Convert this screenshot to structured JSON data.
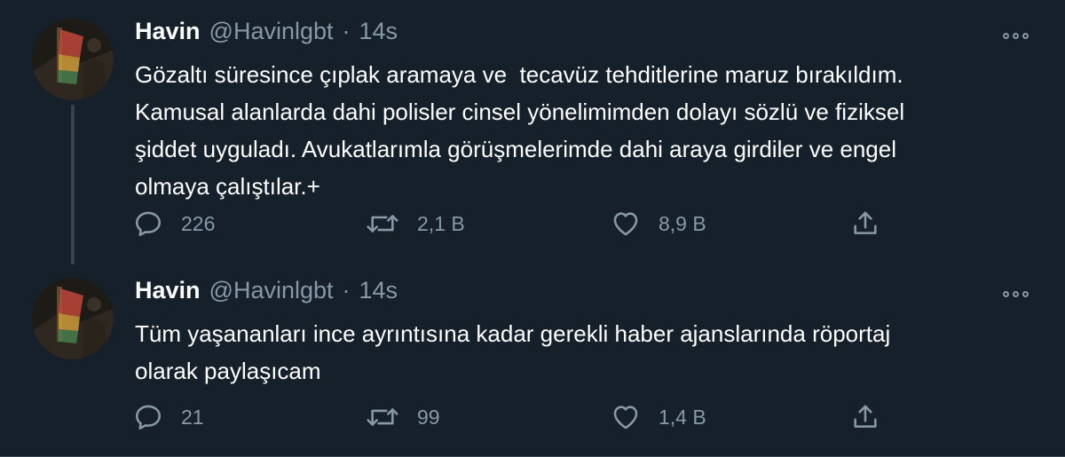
{
  "tweets": [
    {
      "author_name": "Havin",
      "handle": "@Havinlgbt",
      "separator": "·",
      "time": "14s",
      "text": "Gözaltı süresince çıplak aramaya ve  tecavüz tehditlerine maruz bırakıldım.\nKamusal alanlarda dahi polisler cinsel yönelimimden dolayı sözlü ve fiziksel\nşiddet uyguladı. Avukatlarımla görüşmelerimde dahi araya girdiler ve engel\nolmaya çalıştılar.+",
      "replies": "226",
      "retweets": "2,1 B",
      "likes": "8,9 B"
    },
    {
      "author_name": "Havin",
      "handle": "@Havinlgbt",
      "separator": "·",
      "time": "14s",
      "text": "Tüm yaşananları ince ayrıntısına kadar gerekli haber ajanslarında röportaj\nolarak paylaşıcam",
      "replies": "21",
      "retweets": "99",
      "likes": "1,4 B"
    }
  ],
  "icons": {
    "reply": "reply-icon",
    "retweet": "retweet-icon",
    "like": "heart-icon",
    "share": "share-icon",
    "more": "more-options-icon"
  },
  "colors": {
    "background": "#15202b",
    "text": "#ffffff",
    "muted": "#8899a6",
    "line": "#38444d"
  }
}
